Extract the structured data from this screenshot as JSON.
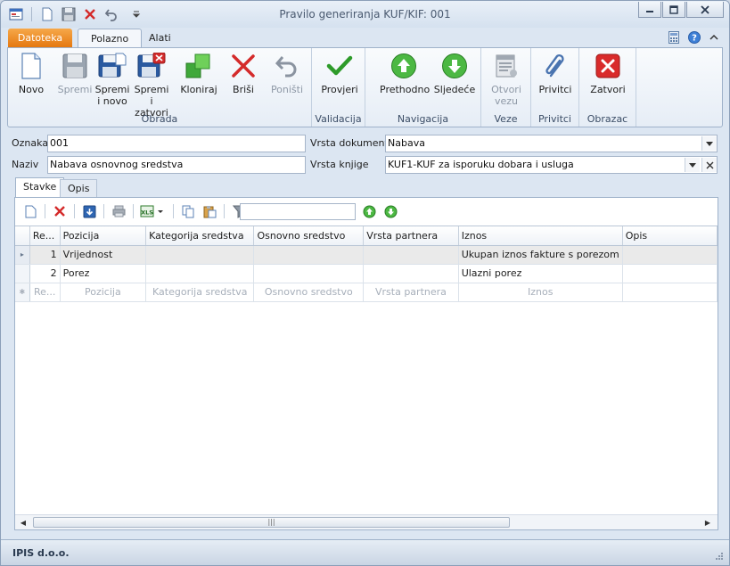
{
  "window": {
    "title": "Pravilo generiranja KUF/KIF: 001"
  },
  "ribbon_tabs": {
    "app": "Datoteka",
    "home": "Polazno",
    "tools": "Alati"
  },
  "ribbon": {
    "groups": {
      "obrada": "Obrada",
      "validacija": "Validacija",
      "navigacija": "Navigacija",
      "veze": "Veze",
      "privitci": "Privitci",
      "obrazac": "Obrazac"
    },
    "buttons": {
      "novo": "Novo",
      "spremi": "Spremi",
      "spremi_i_novo": "Spremi\ni novo",
      "spremi_i_zatvori": "Spremi i\nzatvori",
      "kloniraj": "Kloniraj",
      "brisi": "Briši",
      "ponisti": "Poništi",
      "provjeri": "Provjeri",
      "prethodno": "Prethodno",
      "sljedece": "Sljedeće",
      "otvori_vezu": "Otvori\nvezu",
      "privitci": "Privitci",
      "zatvori": "Zatvori"
    }
  },
  "form": {
    "oznaka_label": "Oznaka",
    "oznaka_value": "001",
    "naziv_label": "Naziv",
    "naziv_value": "Nabava osnovnog sredstva",
    "vrsta_dokumenta_label": "Vrsta dokumenta",
    "vrsta_dokumenta_value": "Nabava",
    "vrsta_knjige_label": "Vrsta knjige",
    "vrsta_knjige_value": "KUF1-KUF za isporuku dobara i usluga"
  },
  "inner_tabs": {
    "stavke": "Stavke",
    "opis": "Opis"
  },
  "grid": {
    "columns": [
      "Re...",
      "Pozicija",
      "Kategorija sredstva",
      "Osnovno sredstvo",
      "Vrsta partnera",
      "Iznos",
      "Opis"
    ],
    "rows": [
      [
        "1",
        "Vrijednost",
        "",
        "",
        "",
        "Ukupan iznos fakture s porezom",
        ""
      ],
      [
        "2",
        "Porez",
        "",
        "",
        "",
        "Ulazni porez",
        ""
      ]
    ],
    "new_row": [
      "Re...",
      "Pozicija",
      "Kategorija sredstva",
      "Osnovno sredstvo",
      "Vrsta partnera",
      "Iznos",
      ""
    ]
  },
  "status": {
    "company": "IPIS d.o.o."
  }
}
